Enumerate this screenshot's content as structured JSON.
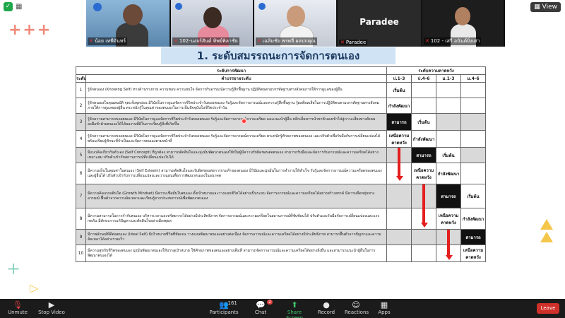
{
  "window": {
    "view_label": "View"
  },
  "slide": {
    "title": "1. ระดับสมรรถนะการจัดการตนเอง",
    "header_dev": "ระดับการพัฒนา",
    "header_expect": "ระดับความคาดหวัง",
    "header_level": "ระดับ",
    "header_desc": "คำบรรยายระดับ",
    "grades": [
      "ป.1-3",
      "ป.4-6",
      "ม.1-3",
      "ม.4-6"
    ],
    "rows": [
      {
        "n": "1",
        "desc": "รู้จักตนเอง (Knowing Self) ทางด้านร่างกาย ความชอบ ความสนใจ จัดการกับอารมณ์ความรู้สึกพื้นฐาน ปฏิบัติตนตามบรรทัดฐานทางสังคมภายใต้การดูแลของผู้อื่น"
      },
      {
        "n": "2",
        "desc": "รู้จักตนเองในคุณสมบัติ จุดแข็งจุดอ่อน มีวินัยในการดูแลจัดการชีวิตประจำวันของตนเอง รับรู้และจัดการอารมณ์และความรู้สึกพื้นฐาน รู้ผลดีผลเสียในการปฏิบัติตนตามบรรทัดฐานทางสังคมภายใต้การดูแลของผู้อื่น ตระหนักรู้ในคุณค่าของตนเองในการเป็นปัจจุบันในชีวิตประจำวัน"
      },
      {
        "n": "3",
        "desc": "รู้จักความสามารถของตนเอง มีวินัยในการดูแลจัดการชีวิตประจำวันของตนเอง รับรู้และจัดการอารมณ์ความเครียด และแนะนำผู้อื่น หลีกเลี่ยงการนำพาตัวเองเข้าไปสู่ภาวะเสี่ยงทางสังคม ลงมือทำด้วยตนเองให้ได้ผลงานที่ดีในการเรียนรู้สิ่งที่เกิดขึ้น"
      },
      {
        "n": "4",
        "desc": "รู้จักความสามารถของตนเอง มีวินัยในการดูแลจัดการชีวิตประจำวันของตนเอง รับรู้และจัดการอารมณ์ความเครียด ตระหนักรู้ศักยภาพของตนเอง และปรับตัวเพื่อรับมือกับการเปลี่ยนแปลงได้ พร้อมเรียนรู้ทักษะที่จำเป็นและจัดการตนเองตามหน้าที่"
      },
      {
        "n": "5",
        "desc": "มีแนวคิดเกี่ยวกับตัวเอง (Self Concept) ที่ถูกต้อง สามารถตัดสินใจและมุ่งมั่นพัฒนาตนเองให้เป็นผู้มีความรับผิดชอบต่อตนเอง สามารถรับมือและจัดการกับอารมณ์และความเครียดได้อย่างเหมาะสม ปรับตัวเข้ากับสถานการณ์ที่เปลี่ยนแปลงไปได้"
      },
      {
        "n": "6",
        "desc": "มีความเห็นในคุณค่าในตนเอง (Self Esteem) สามารถตัดสินใจและรับผิดชอบต่อการกระทำของตนเอง มีวินัยและมุ่งมั่นในการทำงานให้สำเร็จ รับรู้และจัดการอารมณ์ความเครียดของตนเองและผู้อื่นได้ ปรับตัวเข้ากับการเปลี่ยนแปลงและวางแผนเพื่อการพัฒนาตนเองในอนาคต"
      },
      {
        "n": "7",
        "desc": "มีความคิดแบบเติบโต (Growth Mindset) มีความเชื่อมั่นในตนเอง ตั้งเป้าหมายและวางแผนชีวิตได้อย่างเป็นระบบ จัดการอารมณ์และความเครียดได้อย่างสร้างสรรค์ มีความยืดหยุ่นทางอารมณ์ ฟื้นตัวจากความล้มเหลวและเรียนรู้จากประสบการณ์เพื่อพัฒนาตนเอง"
      },
      {
        "n": "8",
        "desc": "มีความสามารถในการกำกับตนเอง บริหารเวลาและทรัพยากรได้อย่างมีประสิทธิภาพ จัดการอารมณ์และความเครียดในสถานการณ์ที่ซับซ้อนได้ ปรับตัวและรับมือกับการเปลี่ยนแปลงและแรงกดดัน มีทักษะการแก้ปัญหาและตัดสินใจอย่างมีเหตุผล"
      },
      {
        "n": "9",
        "desc": "มีภาพลักษณ์ที่ดีต่อตนเอง (Ideal Self) มีเป้าหมายชีวิตที่ชัดเจน วางแผนพัฒนาตนเองอย่างต่อเนื่อง จัดการอารมณ์และความเครียดได้อย่างมีประสิทธิภาพ สามารถฟื้นตัวจากปัญหาและความล้มเหลวได้อย่างรวดเร็ว"
      },
      {
        "n": "10",
        "desc": "มีความสุขกับชีวิตของตนเอง มุ่งมั่นพัฒนาตนเองให้บรรลุเป้าหมาย ใช้ศักยภาพของตนเองอย่างเต็มที่ สามารถจัดการอารมณ์และความเครียดได้อย่างยั่งยืน และสามารถแนะนำผู้อื่นในการพัฒนาตนเองได้"
      }
    ],
    "level_labels": {
      "start": "เริ่มต้น",
      "developing": "กำลังพัฒนา",
      "capable": "สามารถ",
      "beyond": "เหนือความคาดหวัง"
    }
  },
  "participants": [
    {
      "name": "น้อย เทพีจันทร์",
      "muted": true
    },
    {
      "name": "102-นงจร์สันต์ ทิพย์พิลาชัย",
      "muted": true
    },
    {
      "name": "เฉลิมชัย พรพลี ผลปกคุณ",
      "muted": true
    },
    {
      "name": "Paradee",
      "muted": true
    },
    {
      "name": "102 - เสรี อนันต์ยิ่งเศา",
      "muted": true
    }
  ],
  "toolbar": {
    "unmute": "Unmute",
    "stop_video": "Stop Video",
    "participants": "Participants",
    "participants_count": "161",
    "chat": "Chat",
    "chat_badge": "2",
    "share_screen": "Share Screen",
    "record": "Record",
    "reactions": "Reactions",
    "apps": "Apps",
    "leave": "Leave"
  },
  "colors": {
    "accent_green": "#3dc46a",
    "leave_red": "#d0302a",
    "arrow_red": "#e41e1e",
    "title_bg": "#cfe3f5"
  }
}
